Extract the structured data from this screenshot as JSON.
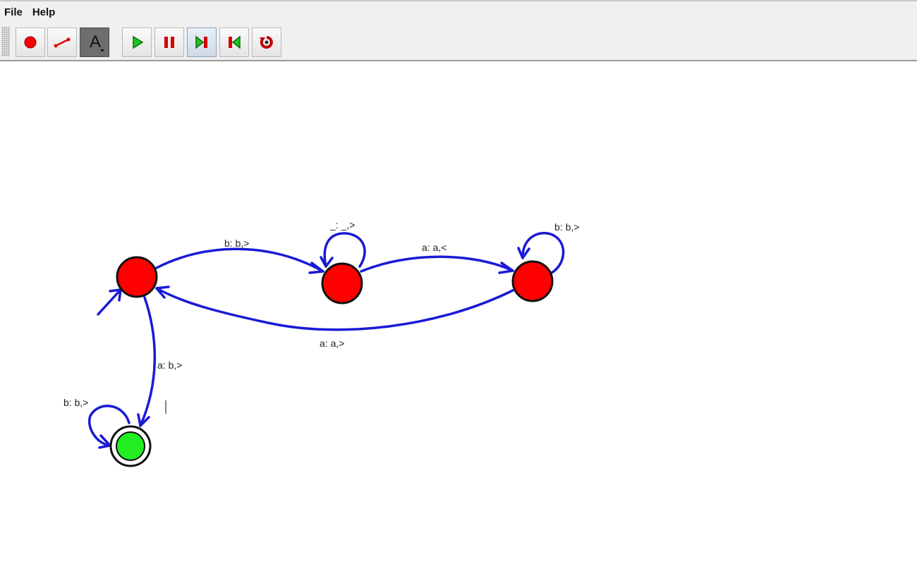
{
  "menubar": {
    "items": [
      {
        "label": "File"
      },
      {
        "label": "Help"
      }
    ]
  },
  "toolbar": {
    "buttons": [
      {
        "name": "add-state-button",
        "icon": "red-circle-icon",
        "selected": false
      },
      {
        "name": "add-transition-button",
        "icon": "red-line-icon",
        "selected": false
      },
      {
        "name": "edit-label-button",
        "icon": "text-a-icon",
        "glyph": "A",
        "selected": true
      },
      {
        "name": "run-button",
        "icon": "play-icon",
        "selected": false
      },
      {
        "name": "pause-button",
        "icon": "pause-icon",
        "selected": false
      },
      {
        "name": "step-forward-button",
        "icon": "step-forward-icon",
        "selected": false,
        "active": true
      },
      {
        "name": "step-back-button",
        "icon": "step-back-icon",
        "selected": false
      },
      {
        "name": "reset-button",
        "icon": "reset-icon",
        "selected": false
      }
    ]
  },
  "diagram": {
    "colors": {
      "state": "#ff0000",
      "accept_state": "#22ee22",
      "edge": "#1a1ad6",
      "outline": "#111111"
    },
    "states": [
      {
        "id": "q0",
        "kind": "initial"
      },
      {
        "id": "q1",
        "kind": "normal"
      },
      {
        "id": "q2",
        "kind": "normal"
      },
      {
        "id": "q3",
        "kind": "accepting"
      }
    ],
    "transitions": [
      {
        "from": "q0",
        "to": "q1",
        "label": "b: b,>"
      },
      {
        "from": "q1",
        "to": "q1",
        "label": "_: _,>"
      },
      {
        "from": "q1",
        "to": "q2",
        "label": "a: a,<"
      },
      {
        "from": "q2",
        "to": "q2",
        "label": "b: b,>"
      },
      {
        "from": "q2",
        "to": "q0",
        "label": "a: a,>"
      },
      {
        "from": "q0",
        "to": "q3",
        "label": "a: b,>"
      },
      {
        "from": "q3",
        "to": "q3",
        "label": "b: b,>"
      }
    ]
  }
}
